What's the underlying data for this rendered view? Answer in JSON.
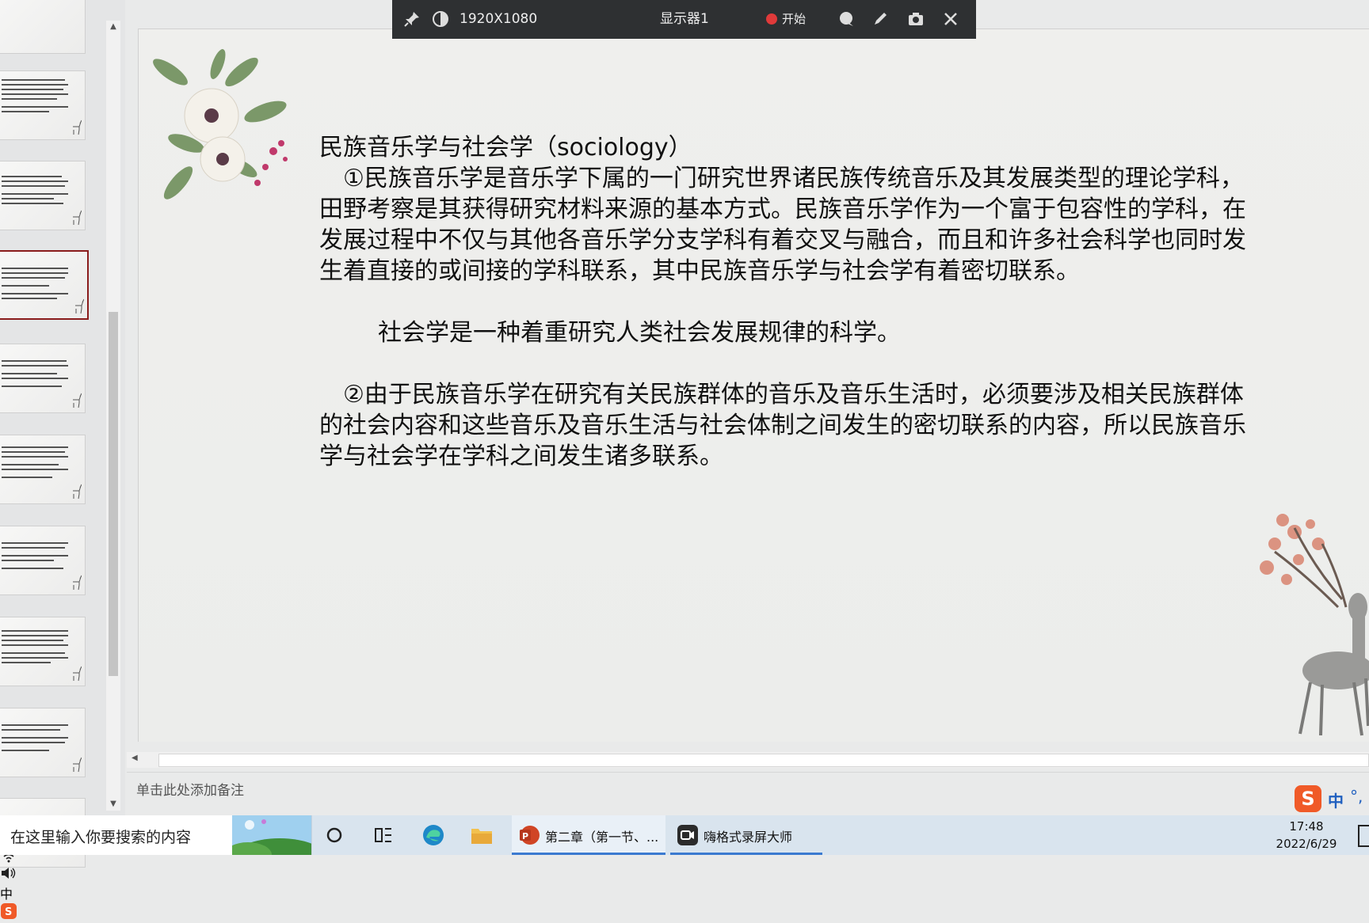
{
  "recorder_bar": {
    "resolution": "1920X1080",
    "display": "显示器1",
    "start_label": "开始"
  },
  "slide": {
    "heading": "民族音乐学与社会学（sociology）",
    "para1": "①民族音乐学是音乐学下属的一门研究世界诸民族传统音乐及其发展类型的理论学科，田野考察是其获得研究材料来源的基本方式。民族音乐学作为一个富于包容性的学科，在发展过程中不仅与其他各音乐学分支学科有着交叉与融合，而且和许多社会科学也同时发生着直接的或间接的学科联系，其中民族音乐学与社会学有着密切联系。",
    "definition": "社会学是一种着重研究人类社会发展规律的科学。",
    "para2": "②由于民族音乐学在研究有关民族群体的音乐及音乐生活时，必须要涉及相关民族群体的社会内容和这些音乐及音乐生活与社会体制之间发生的密切联系的内容，所以民族音乐学与社会学在学科之间发生诸多联系。"
  },
  "notes": {
    "placeholder": "单击此处添加备注"
  },
  "ime": {
    "logo": "S",
    "lang": "中",
    "punct": "°,"
  },
  "taskbar": {
    "search_placeholder": "在这里输入你要搜索的内容",
    "app_ppt_label": "第二章（第一节、...",
    "app_recorder_label": "嗨格式录屏大师",
    "time": "17:48",
    "date": "2022/6/29",
    "tray_ime": "中"
  },
  "colors": {
    "active_thumb_border": "#8a1c1c",
    "rec_dot": "#e03a3a",
    "taskbar_bg": "#d9e4ee",
    "toolbar_bg": "#2e3032"
  }
}
